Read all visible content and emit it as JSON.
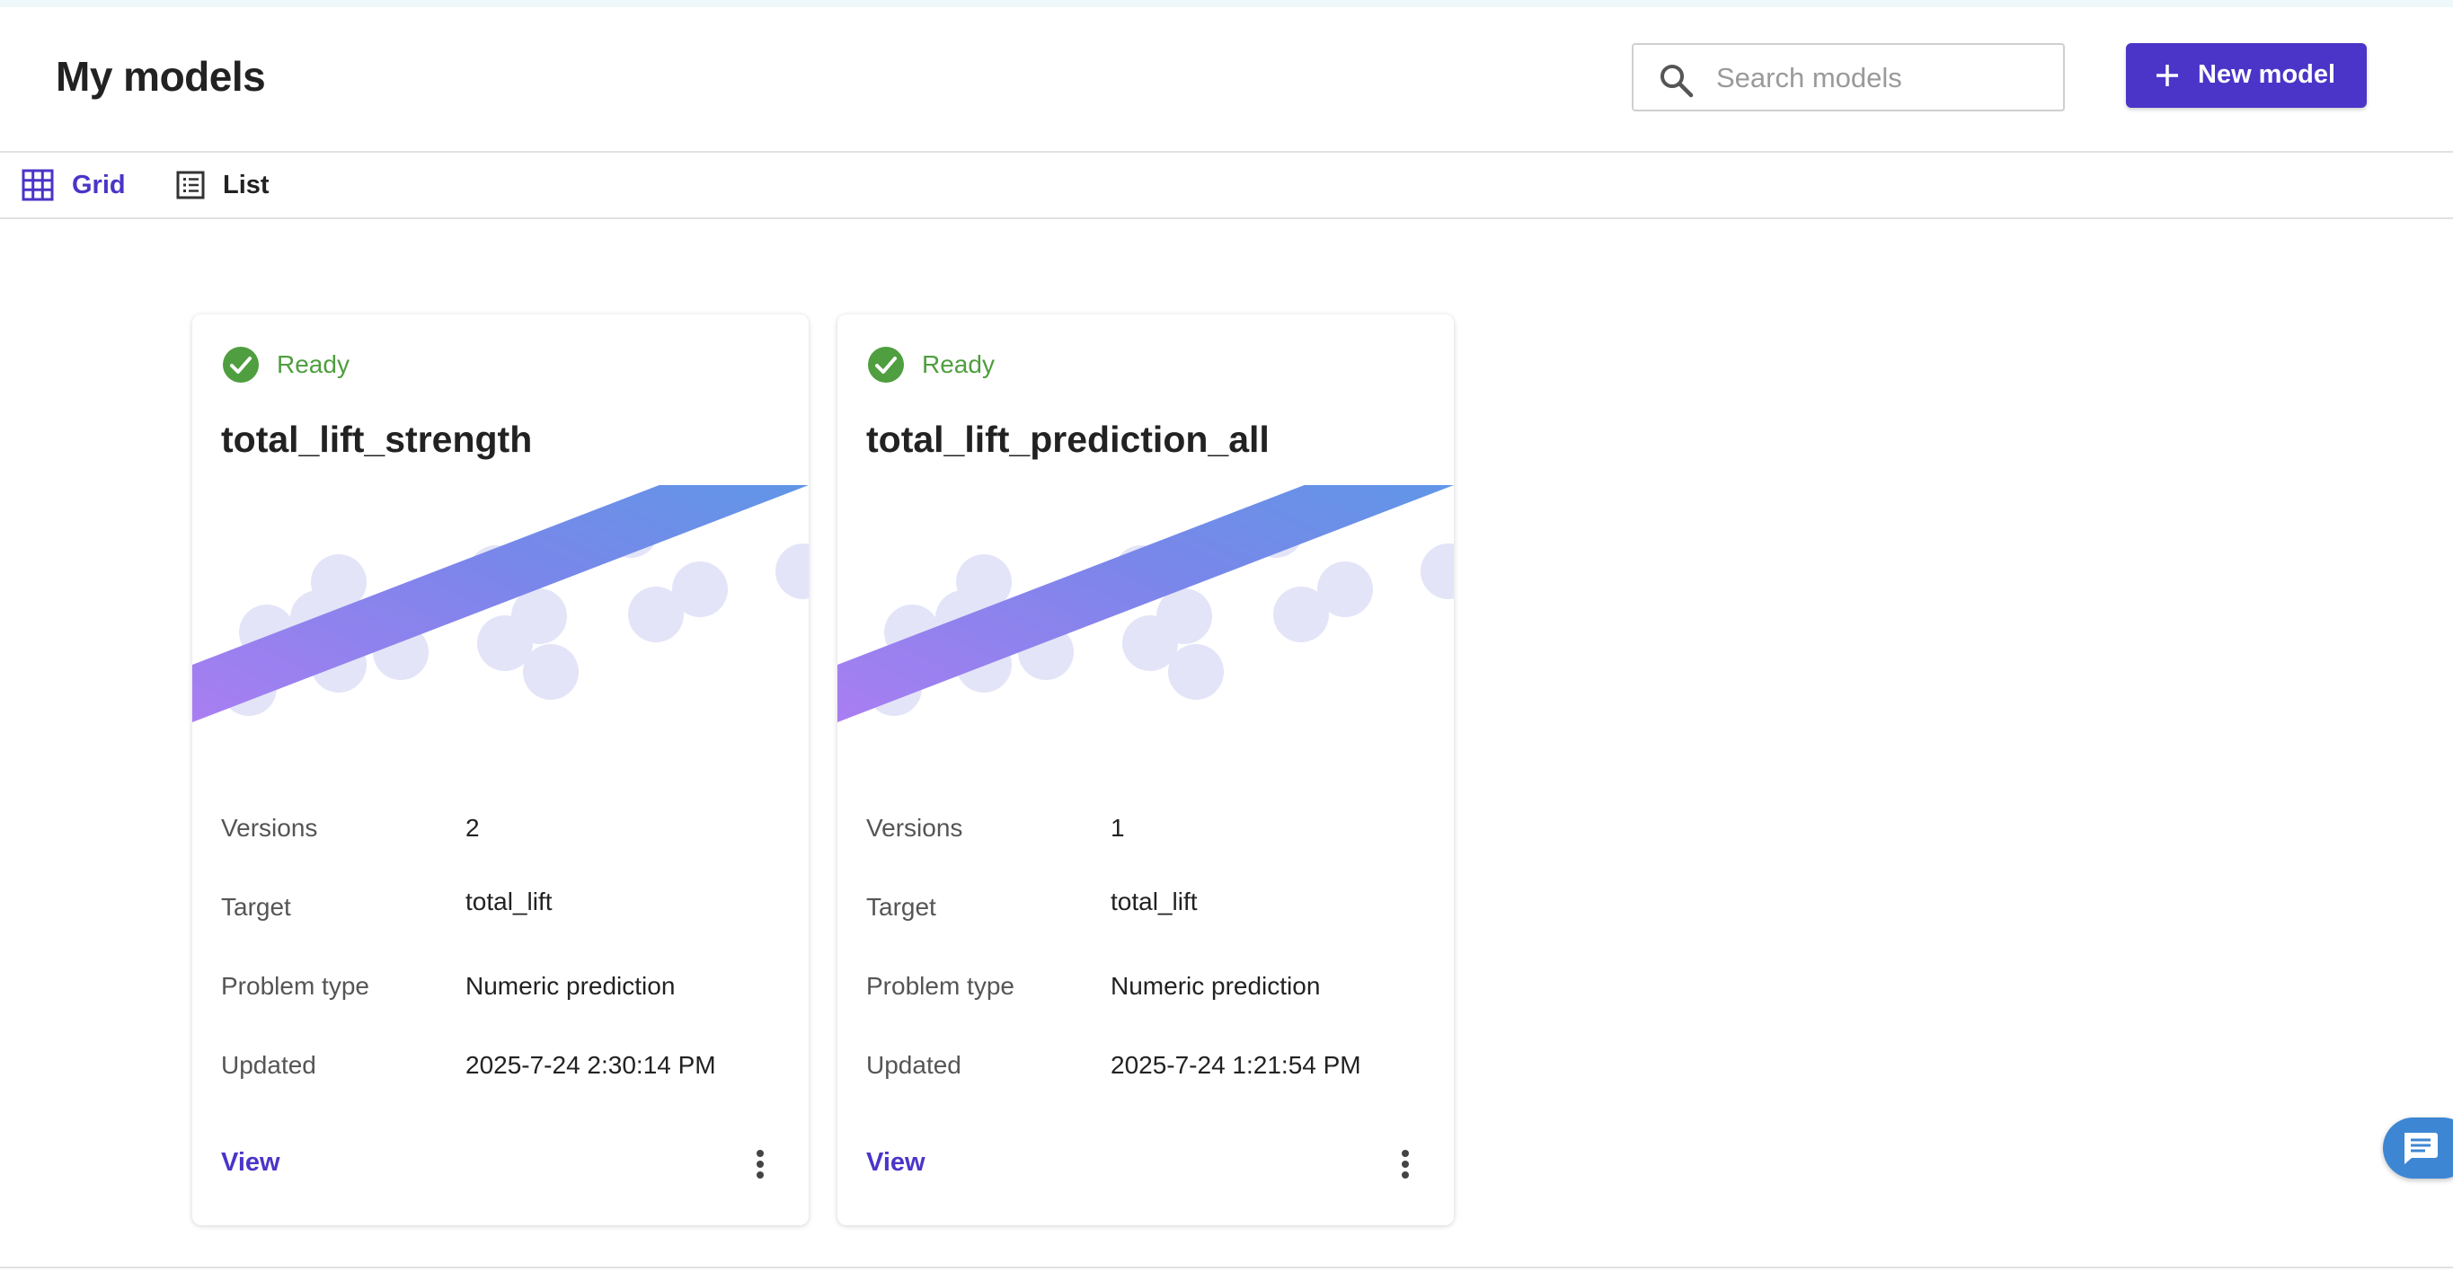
{
  "header": {
    "title": "My models",
    "search_placeholder": "Search models",
    "new_model_label": "New model",
    "accent_color": "#4a35c8"
  },
  "view_tabs": [
    {
      "label": "Grid",
      "icon": "grid-icon",
      "active": true
    },
    {
      "label": "List",
      "icon": "list-icon",
      "active": false
    }
  ],
  "models": [
    {
      "status": "Ready",
      "name": "total_lift_strength",
      "fields": [
        {
          "label": "Versions",
          "value": "2"
        },
        {
          "label": "Target",
          "value": "total_lift"
        },
        {
          "label": "Problem type",
          "value": "Numeric prediction"
        },
        {
          "label": "Updated",
          "value": "2025-7-24 2:30:14 PM"
        }
      ],
      "action_label": "View"
    },
    {
      "status": "Ready",
      "name": "total_lift_prediction_all",
      "fields": [
        {
          "label": "Versions",
          "value": "1"
        },
        {
          "label": "Target",
          "value": "total_lift"
        },
        {
          "label": "Problem type",
          "value": "Numeric prediction"
        },
        {
          "label": "Updated",
          "value": "2025-7-24 1:21:54 PM"
        }
      ],
      "action_label": "View"
    }
  ],
  "status_color": "#4f9e3f",
  "chat_button": {
    "icon": "chat-icon"
  }
}
